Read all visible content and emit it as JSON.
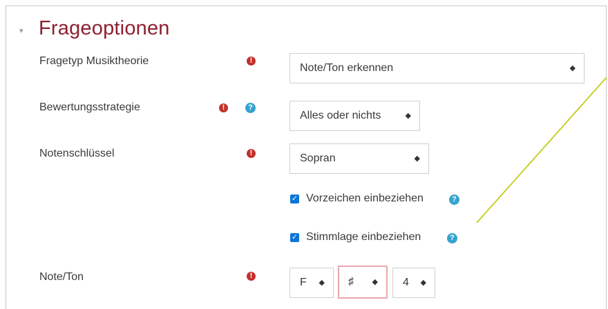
{
  "section": {
    "title": "Frageoptionen",
    "toggle": "▾"
  },
  "fields": {
    "question_type": {
      "label": "Fragetyp Musiktheorie",
      "required_icon": "!",
      "value": "Note/Ton erkennen",
      "arrow": "◆"
    },
    "grading": {
      "label": "Bewertungsstrategie",
      "required_icon": "!",
      "help_icon": "?",
      "value": "Alles oder nichts",
      "arrow": "◆"
    },
    "clef": {
      "label": "Notenschlüssel",
      "required_icon": "!",
      "value": "Sopran",
      "arrow": "◆"
    },
    "include_accidentals": {
      "label": "Vorzeichen einbeziehen",
      "checked": "✓",
      "help_icon": "?"
    },
    "include_register": {
      "label": "Stimmlage einbeziehen",
      "checked": "✓",
      "help_icon": "?"
    },
    "note": {
      "label": "Note/Ton",
      "required_icon": "!",
      "letter": "F",
      "accidental": "♯",
      "octave": "4",
      "arrow": "◆"
    }
  },
  "colors": {
    "title": "#8e1f2f",
    "required": "#c3312c",
    "help": "#36a2cf",
    "checkbox": "#0b75d8",
    "highlight_border": "#e8a6ad",
    "annotation_line": "#c8cf2a"
  },
  "icons": [
    "collapse-caret-icon",
    "required-exclamation-icon",
    "help-question-icon",
    "checkbox-checked-icon",
    "select-arrow-icon"
  ]
}
